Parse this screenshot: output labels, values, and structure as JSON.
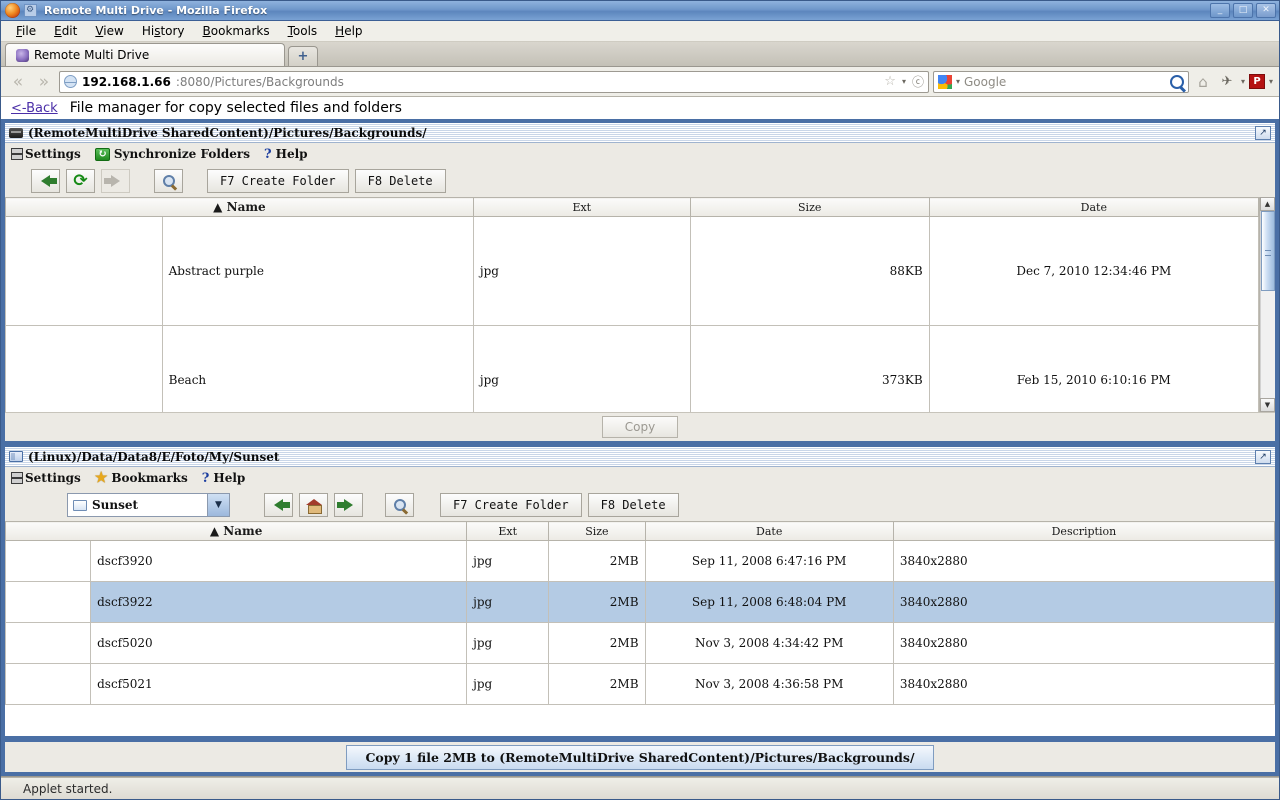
{
  "browser": {
    "window_title": "Remote Multi Drive - Mozilla Firefox",
    "minimize_label": "_",
    "maximize_label": "□",
    "close_label": "✕",
    "menus": [
      "File",
      "Edit",
      "View",
      "History",
      "Bookmarks",
      "Tools",
      "Help"
    ],
    "tab_title": "Remote Multi Drive",
    "newtab_label": "+",
    "back_glyph": "«",
    "forward_glyph": "»",
    "url_host": "192.168.1.66",
    "url_rest": ":8080/Pictures/Backgrounds",
    "star_glyph": "☆",
    "caret_glyph": "▾",
    "rss_glyph": "ⓒ",
    "search_placeholder": "Google",
    "home_glyph": "⌂",
    "plugin_glyph": "✈",
    "red_ext_label": "P"
  },
  "page": {
    "back_link": "<-Back",
    "caption": "File manager for copy selected files and folders"
  },
  "top_panel": {
    "title": "(RemoteMultiDrive SharedContent)/Pictures/Backgrounds/",
    "title_icon": "disk-icon",
    "maximize_glyph": "↗",
    "menu": [
      {
        "label": "Settings",
        "icon": "settings-icon"
      },
      {
        "label": "Synchronize Folders",
        "icon": "sync-icon"
      },
      {
        "label": "Help",
        "icon": "question-icon"
      }
    ],
    "toolbar": {
      "back_icon": "back-arrow-icon",
      "refresh_icon": "refresh-icon",
      "refresh_glyph": "⟳",
      "forward_icon": "forward-arrow-icon",
      "search_icon": "search-icon",
      "create_folder_label": "F7 Create Folder",
      "delete_label": "F8 Delete"
    },
    "columns": [
      "Name",
      "Ext",
      "Size",
      "Date"
    ],
    "sort_glyph": "▲",
    "rows": [
      {
        "thumb": "th-abstract",
        "name": "Abstract purple",
        "ext": "jpg",
        "size": "88KB",
        "date": "Dec 7, 2010 12:34:46 PM"
      },
      {
        "thumb": "th-beach",
        "name": "Beach",
        "ext": "jpg",
        "size": "373KB",
        "date": "Feb 15, 2010 6:10:16 PM"
      }
    ],
    "scroll_up_glyph": "▲",
    "scroll_down_glyph": "▼",
    "copy_label": "Copy"
  },
  "bottom_panel": {
    "title": "(Linux)/Data/Data8/E/Foto/My/Sunset",
    "title_icon": "folder-icon",
    "maximize_glyph": "↗",
    "menu": [
      {
        "label": "Settings",
        "icon": "settings-icon"
      },
      {
        "label": "Bookmarks",
        "icon": "star-icon"
      },
      {
        "label": "Help",
        "icon": "question-icon"
      }
    ],
    "toolbar": {
      "combo_value": "Sunset",
      "combo_caret": "▼",
      "back_icon": "back-arrow-icon",
      "home_icon": "home-icon",
      "forward_icon": "forward-arrow-icon",
      "search_icon": "search-icon",
      "create_folder_label": "F7 Create Folder",
      "delete_label": "F8 Delete"
    },
    "columns": [
      "Name",
      "Ext",
      "Size",
      "Date",
      "Description"
    ],
    "sort_glyph": "▲",
    "rows": [
      {
        "thumb": "th-sunset1",
        "name": "dscf3920",
        "ext": "jpg",
        "size": "2MB",
        "date": "Sep 11, 2008 6:47:16 PM",
        "description": "3840x2880",
        "selected": false
      },
      {
        "thumb": "th-sunset2",
        "name": "dscf3922",
        "ext": "jpg",
        "size": "2MB",
        "date": "Sep 11, 2008 6:48:04 PM",
        "description": "3840x2880",
        "selected": true
      },
      {
        "thumb": "th-sunset3",
        "name": "dscf5020",
        "ext": "jpg",
        "size": "2MB",
        "date": "Nov 3, 2008 4:34:42 PM",
        "description": "3840x2880",
        "selected": false
      },
      {
        "thumb": "th-sunset4",
        "name": "dscf5021",
        "ext": "jpg",
        "size": "2MB",
        "date": "Nov 3, 2008 4:36:58 PM",
        "description": "3840x2880",
        "selected": false
      }
    ]
  },
  "action_bar": {
    "copy_label": "Copy 1 file 2MB to (RemoteMultiDrive SharedContent)/Pictures/Backgrounds/"
  },
  "status": {
    "text": "Applet started."
  },
  "colors": {
    "chrome_blue": "#4a6fa5",
    "selection_blue": "#b4cbe4",
    "link_purple": "#4b2fa8",
    "toolbar_bg": "#eceae4"
  }
}
